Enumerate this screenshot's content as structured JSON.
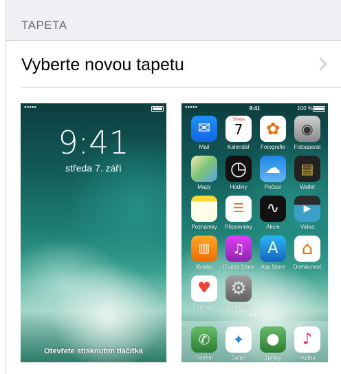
{
  "section_header": "TAPETA",
  "choose_row": {
    "label": "Vyberte novou tapetu"
  },
  "lock_screen": {
    "status": {
      "signal": "●●●●● ",
      "battery_label": ""
    },
    "time": "9:41",
    "date": "středa 7. září",
    "hint": "Otevřete stisknutím tlačítka"
  },
  "home_screen": {
    "status": {
      "signal": "●●●●● ",
      "time": "9:41",
      "battery_percent": "100 %"
    },
    "apps": [
      {
        "name": "Mail",
        "icon": "mail-icon"
      },
      {
        "name": "Kalendář",
        "icon": "calendar-icon",
        "weekday": "Středa",
        "day": "7"
      },
      {
        "name": "Fotografie",
        "icon": "photos-icon"
      },
      {
        "name": "Fotoaparát",
        "icon": "camera-icon"
      },
      {
        "name": "Mapy",
        "icon": "maps-icon"
      },
      {
        "name": "Hodiny",
        "icon": "clock-icon"
      },
      {
        "name": "Počasí",
        "icon": "weather-icon"
      },
      {
        "name": "Wallet",
        "icon": "wallet-icon"
      },
      {
        "name": "Poznámky",
        "icon": "notes-icon"
      },
      {
        "name": "Připomínky",
        "icon": "reminders-icon"
      },
      {
        "name": "Akcie",
        "icon": "stocks-icon"
      },
      {
        "name": "Videa",
        "icon": "videos-icon"
      },
      {
        "name": "iBooks",
        "icon": "ibooks-icon"
      },
      {
        "name": "iTunes Store",
        "icon": "itunes-store-icon"
      },
      {
        "name": "App Store",
        "icon": "app-store-icon"
      },
      {
        "name": "Domácnost",
        "icon": "home-app-icon"
      },
      {
        "name": "Zdraví",
        "icon": "health-icon"
      },
      {
        "name": "Nastavení",
        "icon": "settings-icon"
      }
    ],
    "dock": [
      {
        "name": "Telefon",
        "icon": "phone-icon"
      },
      {
        "name": "Safari",
        "icon": "safari-icon"
      },
      {
        "name": "Zprávy",
        "icon": "messages-icon"
      },
      {
        "name": "Hudba",
        "icon": "music-icon"
      }
    ]
  },
  "colors": {
    "grouped_background": "#efeff4",
    "separator": "#c8c7cc",
    "header_text": "#6d6d72",
    "chevron": "#c7c7cc"
  }
}
